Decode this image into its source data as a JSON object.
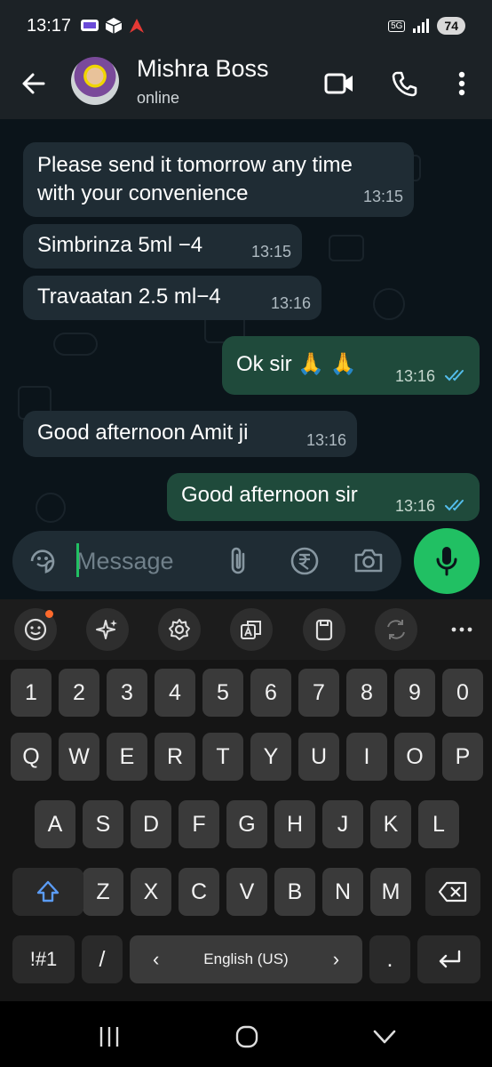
{
  "status_bar": {
    "time": "13:17",
    "battery": "74",
    "network": "5G"
  },
  "header": {
    "contact_name": "Mishra Boss",
    "status": "online"
  },
  "messages": [
    {
      "direction": "in",
      "lines": [
        "Please send it tomorrow any time",
        "with your convenience"
      ],
      "time": "13:15"
    },
    {
      "direction": "in",
      "lines": [
        "Simbrinza 5ml −4"
      ],
      "time": "13:15"
    },
    {
      "direction": "in",
      "lines": [
        "Travaatan 2.5 ml−4"
      ],
      "time": "13:16"
    },
    {
      "direction": "out",
      "lines": [
        "Ok sir 🙏 🙏"
      ],
      "time": "13:16",
      "read": true
    },
    {
      "direction": "in",
      "lines": [
        "Good afternoon Amit ji"
      ],
      "time": "13:16"
    },
    {
      "direction": "out",
      "lines": [
        "Good afternoon sir"
      ],
      "time": "13:16",
      "read": true
    }
  ],
  "composer": {
    "placeholder": "Message"
  },
  "keyboard": {
    "toolbar": [
      "emoji-icon",
      "sparkle-icon",
      "settings-icon",
      "translate-icon",
      "clipboard-icon",
      "swap-icon",
      "more-icon"
    ],
    "row_numbers": [
      "1",
      "2",
      "3",
      "4",
      "5",
      "6",
      "7",
      "8",
      "9",
      "0"
    ],
    "row1": [
      "Q",
      "W",
      "E",
      "R",
      "T",
      "Y",
      "U",
      "I",
      "O",
      "P"
    ],
    "row2": [
      "A",
      "S",
      "D",
      "F",
      "G",
      "H",
      "J",
      "K",
      "L"
    ],
    "row3": [
      "Z",
      "X",
      "C",
      "V",
      "B",
      "N",
      "M"
    ],
    "symbols_label": "!#1",
    "slash_label": "/",
    "space_label": "English (US)",
    "space_left": "‹",
    "space_right": "›",
    "period_label": "."
  },
  "colors": {
    "accent": "#21c063",
    "outgoing_bubble": "#1f4a3b",
    "incoming_bubble": "#1f2c34",
    "read_ticks": "#53bdeb"
  }
}
